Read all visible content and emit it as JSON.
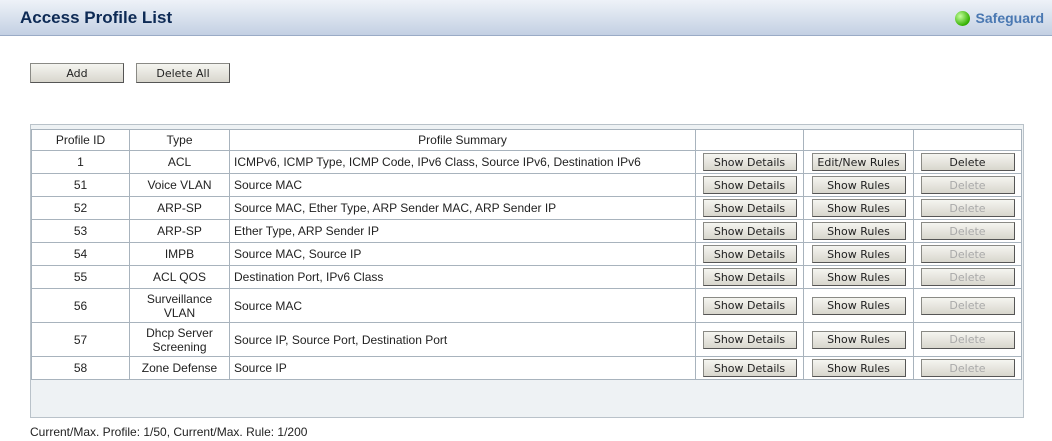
{
  "header": {
    "title": "Access Profile List",
    "safeguard_label": "Safeguard",
    "safeguard_color": "#33b000"
  },
  "toolbar": {
    "add_label": "Add",
    "delete_all_label": "Delete All"
  },
  "table": {
    "columns": [
      "Profile ID",
      "Type",
      "Profile Summary",
      "",
      "",
      ""
    ],
    "rows": [
      {
        "id": "1",
        "type": "ACL",
        "summary": "ICMPv6, ICMP Type, ICMP Code, IPv6 Class, Source IPv6, Destination IPv6",
        "details": "Show Details",
        "rules": "Edit/New Rules",
        "delete": "Delete",
        "delete_enabled": true
      },
      {
        "id": "51",
        "type": "Voice VLAN",
        "summary": "Source MAC",
        "details": "Show Details",
        "rules": "Show Rules",
        "delete": "Delete",
        "delete_enabled": false
      },
      {
        "id": "52",
        "type": "ARP-SP",
        "summary": "Source MAC, Ether Type, ARP Sender MAC, ARP Sender IP",
        "details": "Show Details",
        "rules": "Show Rules",
        "delete": "Delete",
        "delete_enabled": false
      },
      {
        "id": "53",
        "type": "ARP-SP",
        "summary": "Ether Type, ARP Sender IP",
        "details": "Show Details",
        "rules": "Show Rules",
        "delete": "Delete",
        "delete_enabled": false
      },
      {
        "id": "54",
        "type": "IMPB",
        "summary": "Source MAC, Source IP",
        "details": "Show Details",
        "rules": "Show Rules",
        "delete": "Delete",
        "delete_enabled": false
      },
      {
        "id": "55",
        "type": "ACL QOS",
        "summary": "Destination Port, IPv6 Class",
        "details": "Show Details",
        "rules": "Show Rules",
        "delete": "Delete",
        "delete_enabled": false
      },
      {
        "id": "56",
        "type": "Surveillance VLAN",
        "summary": "Source MAC",
        "details": "Show Details",
        "rules": "Show Rules",
        "delete": "Delete",
        "delete_enabled": false
      },
      {
        "id": "57",
        "type": "Dhcp Server Screening",
        "summary": "Source IP, Source Port, Destination Port",
        "details": "Show Details",
        "rules": "Show Rules",
        "delete": "Delete",
        "delete_enabled": false
      },
      {
        "id": "58",
        "type": "Zone Defense",
        "summary": "Source IP",
        "details": "Show Details",
        "rules": "Show Rules",
        "delete": "Delete",
        "delete_enabled": false
      }
    ]
  },
  "footer": {
    "status": "Current/Max. Profile: 1/50, Current/Max. Rule: 1/200"
  }
}
